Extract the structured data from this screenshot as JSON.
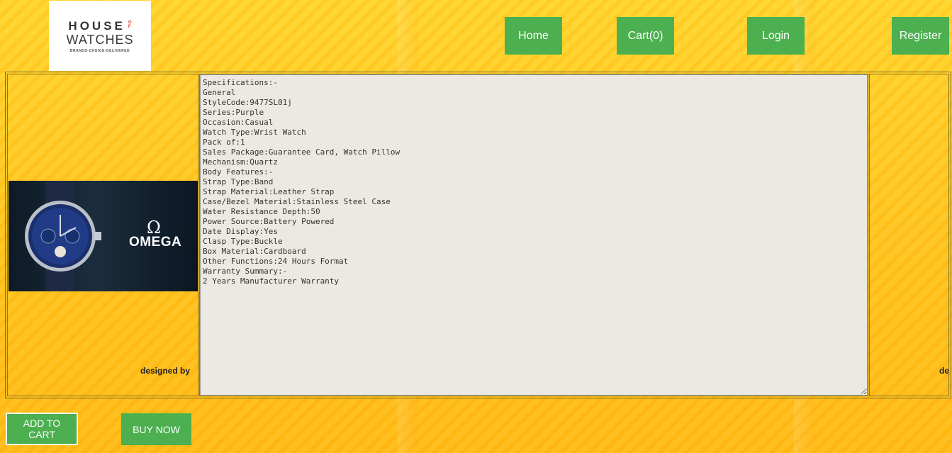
{
  "logo": {
    "house": "HOUSE",
    "of": [
      "O",
      "F"
    ],
    "watches": "WATCHES",
    "tagline": "BRANDS·CHOICE·DELIVERED"
  },
  "nav": {
    "home": "Home",
    "cart": "Cart(0)",
    "login": "Login",
    "register": "Register"
  },
  "product": {
    "brand_text": "OMEGA",
    "brand_symbol": "Ω",
    "designed_by": "designed by",
    "designed_by_partial": "des",
    "specifications": "Specifications:-\nGeneral\nStyleCode:9477SL01j\nSeries:Purple\nOccasion:Casual\nWatch Type:Wrist Watch\nPack of:1\nSales Package:Guarantee Card, Watch Pillow\nMechanism:Quartz\nBody Features:-\nStrap Type:Band\nStrap Material:Leather Strap\nCase/Bezel Material:Stainless Steel Case\nWater Resistance Depth:50\nPower Source:Battery Powered\nDate Display:Yes\nClasp Type:Buckle\nBox Material:Cardboard\nOther Functions:24 Hours Format\nWarranty Summary:-\n2 Years Manufacturer Warranty"
  },
  "actions": {
    "add_to_cart": "ADD TO CART",
    "buy_now": "BUY NOW"
  },
  "colors": {
    "button_green": "#4caf50",
    "background_yellow": "#ffc21e"
  }
}
